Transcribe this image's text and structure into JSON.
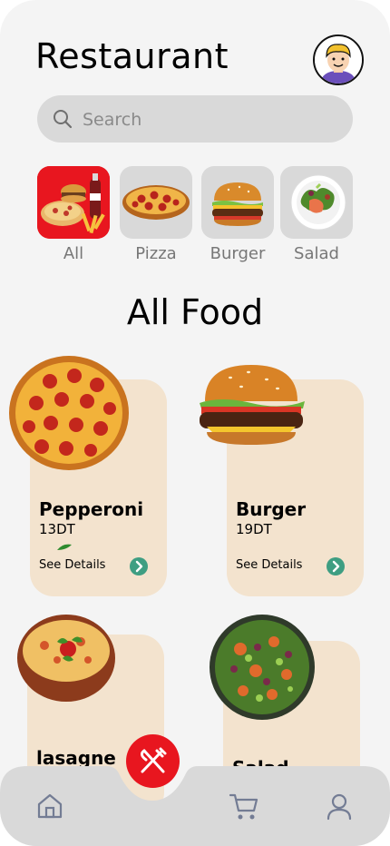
{
  "header": {
    "title": "Restaurant"
  },
  "search": {
    "placeholder": "Search",
    "value": ""
  },
  "categories": [
    {
      "label": "All",
      "active": true
    },
    {
      "label": "Pizza",
      "active": false
    },
    {
      "label": "Burger",
      "active": false
    },
    {
      "label": "Salad",
      "active": false
    }
  ],
  "section": {
    "title": "All Food"
  },
  "foods": [
    {
      "name": "Pepperoni",
      "price": "13DT",
      "details_label": "See Details"
    },
    {
      "name": "Burger",
      "price": "19DT",
      "details_label": "See Details"
    },
    {
      "name": "lasagne",
      "price": "",
      "details_label": ""
    },
    {
      "name": "Salad",
      "price": "",
      "details_label": ""
    }
  ],
  "nav": {
    "items": [
      "home-icon",
      "cart-icon",
      "user-icon"
    ]
  },
  "colors": {
    "accent": "#e8161f",
    "card": "#f3e3ce",
    "go": "#3e9e82",
    "bg": "#f4f4f4",
    "nav": "#d9d9d9"
  }
}
